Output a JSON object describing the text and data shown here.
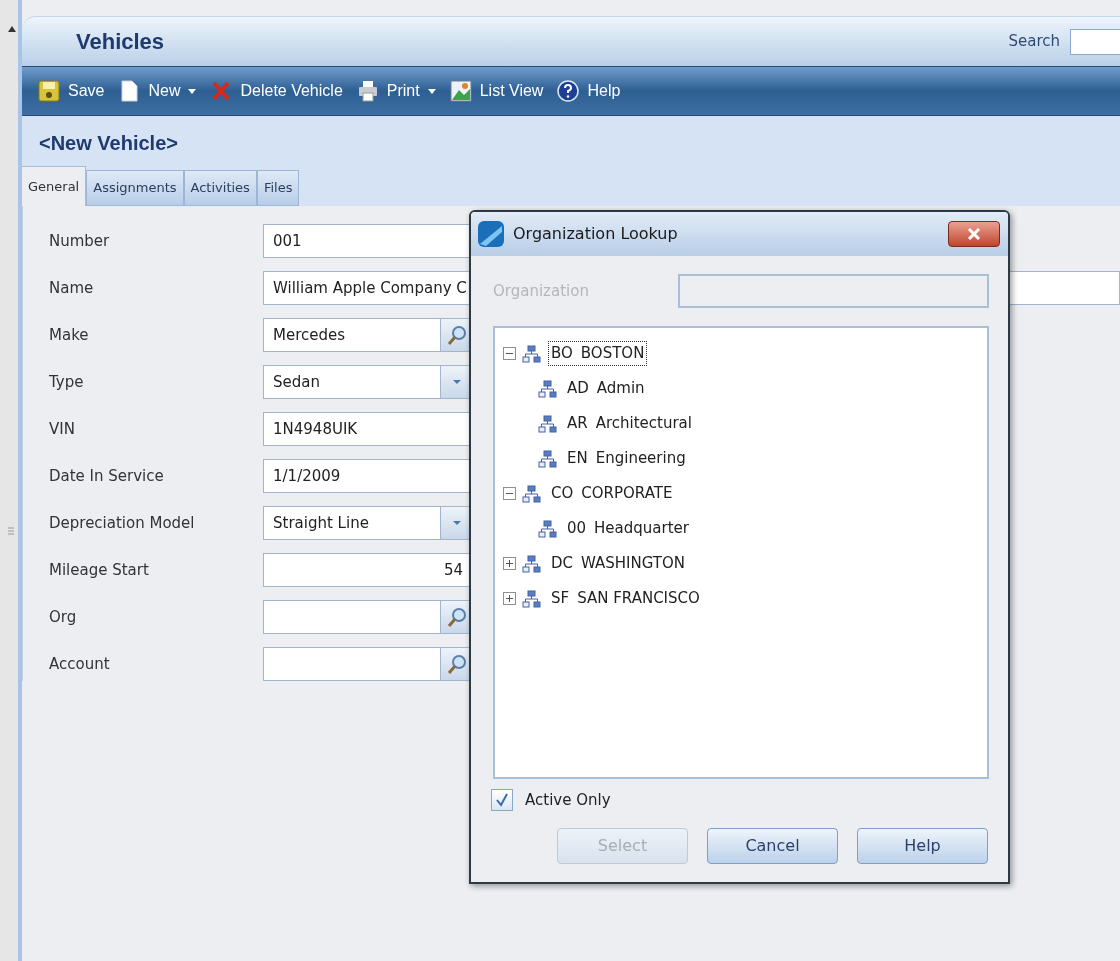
{
  "header": {
    "title": "Vehicles",
    "search_label": "Search"
  },
  "toolbar": [
    {
      "kind": "save",
      "label": "Save",
      "dropdown": false
    },
    {
      "kind": "new",
      "label": "New",
      "dropdown": true
    },
    {
      "kind": "delete",
      "label": "Delete Vehicle",
      "dropdown": false
    },
    {
      "kind": "print",
      "label": "Print",
      "dropdown": true
    },
    {
      "kind": "listview",
      "label": "List View",
      "dropdown": false
    },
    {
      "kind": "help",
      "label": "Help",
      "dropdown": false
    }
  ],
  "record_title": "<New Vehicle>",
  "tabs": [
    {
      "label": "General",
      "selected": true
    },
    {
      "label": "Assignments",
      "selected": false
    },
    {
      "label": "Activities",
      "selected": false
    },
    {
      "label": "Files",
      "selected": false
    }
  ],
  "fields": [
    {
      "label": "Number",
      "kind": "text",
      "value": "001"
    },
    {
      "label": "Name",
      "kind": "wide",
      "value": "William Apple Company C"
    },
    {
      "label": "Make",
      "kind": "lookup",
      "value": "Mercedes"
    },
    {
      "label": "Type",
      "kind": "dropdown",
      "value": "Sedan"
    },
    {
      "label": "VIN",
      "kind": "text",
      "value": "1N4948UIK"
    },
    {
      "label": "Date In Service",
      "kind": "text",
      "value": "1/1/2009"
    },
    {
      "label": "Depreciation Model",
      "kind": "dropdown",
      "value": "Straight Line"
    },
    {
      "label": "Mileage Start",
      "kind": "number",
      "value": "54"
    },
    {
      "label": "Org",
      "kind": "lookup"
    },
    {
      "label": "Account",
      "kind": "lookup"
    }
  ],
  "dialog": {
    "title": "Organization Lookup",
    "filter_label": "Organization",
    "filter_disabled": true,
    "tree": [
      {
        "code": "BO",
        "name": "BOSTON",
        "expanded": true,
        "selected": true,
        "children": [
          {
            "code": "AD",
            "name": "Admin",
            "selected": false
          },
          {
            "code": "AR",
            "name": "Architectural",
            "selected": false
          },
          {
            "code": "EN",
            "name": "Engineering",
            "selected": false
          }
        ]
      },
      {
        "code": "CO",
        "name": "CORPORATE",
        "expanded": true,
        "selected": false,
        "children": [
          {
            "code": "00",
            "name": "Headquarter",
            "selected": false
          }
        ]
      },
      {
        "code": "DC",
        "name": "WASHINGTON",
        "expanded": false,
        "selected": false
      },
      {
        "code": "SF",
        "name": "SAN FRANCISCO",
        "expanded": false,
        "selected": false
      }
    ],
    "active_only": {
      "label": "Active Only",
      "checked": true
    },
    "buttons": [
      {
        "label": "Select",
        "disabled": true
      },
      {
        "label": "Cancel",
        "disabled": false
      },
      {
        "label": "Help",
        "disabled": false
      }
    ]
  }
}
